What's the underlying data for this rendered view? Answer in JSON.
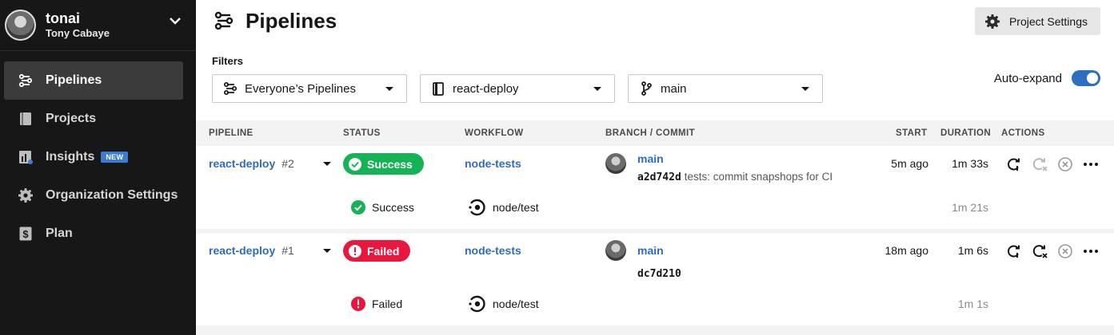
{
  "user": {
    "org": "tonai",
    "name": "Tony Cabaye"
  },
  "nav": {
    "items": [
      {
        "label": "Pipelines",
        "icon": "pipelines-icon",
        "active": true
      },
      {
        "label": "Projects",
        "icon": "book-icon"
      },
      {
        "label": "Insights",
        "icon": "chart-icon",
        "badge": "NEW"
      },
      {
        "label": "Organization Settings",
        "icon": "gear-icon"
      },
      {
        "label": "Plan",
        "icon": "dollar-icon"
      }
    ]
  },
  "header": {
    "title": "Pipelines",
    "settings_label": "Project Settings"
  },
  "filters": {
    "label": "Filters",
    "owner": "Everyone’s Pipelines",
    "project": "react-deploy",
    "branch": "main",
    "autoexpand_label": "Auto-expand",
    "autoexpand_on": true
  },
  "table": {
    "columns": [
      "PIPELINE",
      "STATUS",
      "WORKFLOW",
      "BRANCH / COMMIT",
      "START",
      "DURATION",
      "ACTIONS"
    ],
    "rows": [
      {
        "pipeline": "react-deploy",
        "number": "#2",
        "status": "Success",
        "workflow": "node-tests",
        "branch": "main",
        "commit": "a2d742d",
        "message": "tests: commit snapshops for CI",
        "start": "5m ago",
        "duration": "1m 33s",
        "job": {
          "status": "Success",
          "name": "node/test",
          "duration": "1m 21s"
        }
      },
      {
        "pipeline": "react-deploy",
        "number": "#1",
        "status": "Failed",
        "workflow": "node-tests",
        "branch": "main",
        "commit": "dc7d210",
        "message": "",
        "start": "18m ago",
        "duration": "1m 6s",
        "job": {
          "status": "Failed",
          "name": "node/test",
          "duration": "1m 1s"
        }
      }
    ]
  },
  "colors": {
    "success": "#16b356",
    "failed": "#e8173e",
    "link": "#2e6bbf",
    "sidebar": "#171717"
  }
}
